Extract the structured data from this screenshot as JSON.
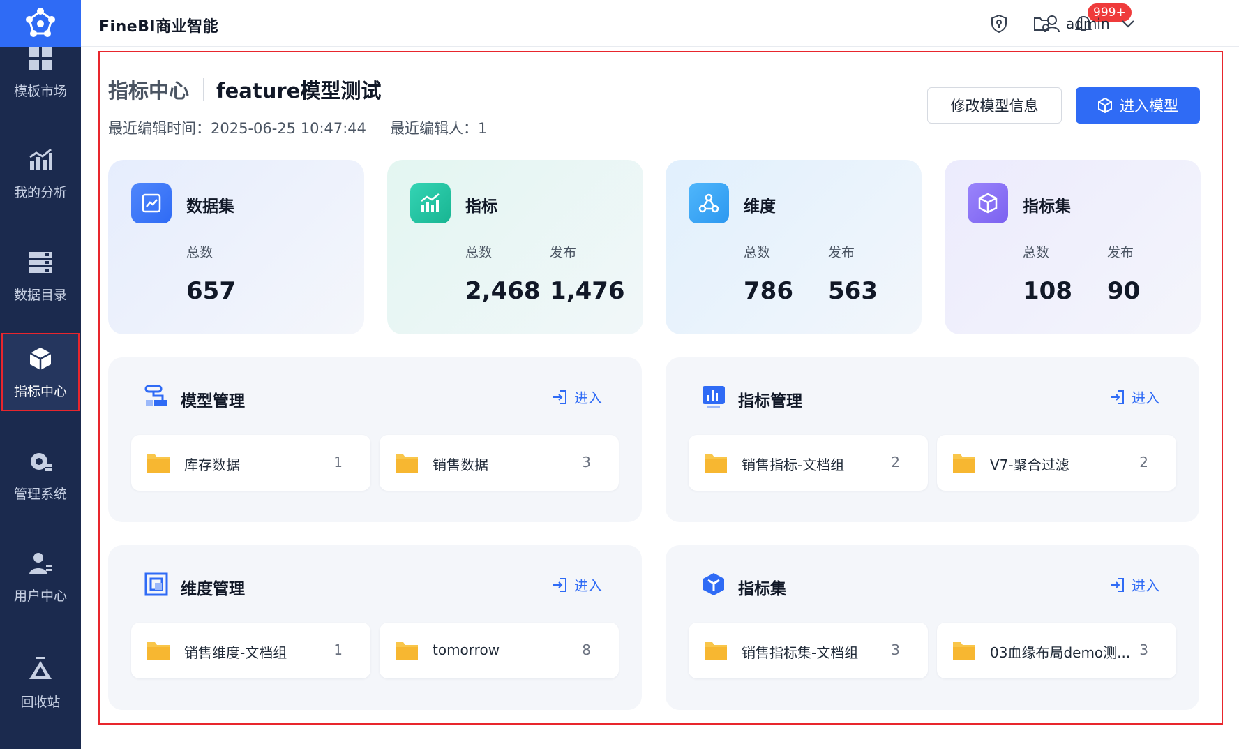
{
  "header": {
    "brand": "FineBI商业智能",
    "notification_badge": "999+",
    "user_name": "admin"
  },
  "sidebar": {
    "items": [
      {
        "label": "模板市场",
        "icon": "template-market-icon"
      },
      {
        "label": "我的分析",
        "icon": "analysis-chart-icon"
      },
      {
        "label": "数据目录",
        "icon": "data-catalog-icon"
      },
      {
        "label": "指标中心",
        "icon": "metric-center-cube-icon",
        "active": true
      },
      {
        "label": "管理系统",
        "icon": "gear-icon"
      },
      {
        "label": "用户中心",
        "icon": "user-icon"
      },
      {
        "label": "回收站",
        "icon": "recycle-icon"
      }
    ]
  },
  "page": {
    "section": "指标中心",
    "model_name": "feature模型测试",
    "last_edit_time": "最近编辑时间：2025-06-25 10:47:44",
    "last_editor": "最近编辑人：1",
    "btn_edit": "修改模型信息",
    "btn_enter": "进入模型"
  },
  "stats": [
    {
      "title": "数据集",
      "total_label": "总数",
      "total": "657"
    },
    {
      "title": "指标",
      "total_label": "总数",
      "total": "2,468",
      "pub_label": "发布",
      "pub": "1,476"
    },
    {
      "title": "维度",
      "total_label": "总数",
      "total": "786",
      "pub_label": "发布",
      "pub": "563"
    },
    {
      "title": "指标集",
      "total_label": "总数",
      "total": "108",
      "pub_label": "发布",
      "pub": "90"
    }
  ],
  "sections": [
    {
      "title": "模型管理",
      "enter": "进入",
      "items": [
        {
          "name": "库存数据",
          "count": "1"
        },
        {
          "name": "销售数据",
          "count": "3"
        }
      ]
    },
    {
      "title": "指标管理",
      "enter": "进入",
      "items": [
        {
          "name": "销售指标-文档组",
          "count": "2"
        },
        {
          "name": "V7-聚合过滤",
          "count": "2"
        }
      ]
    },
    {
      "title": "维度管理",
      "enter": "进入",
      "items": [
        {
          "name": "销售维度-文档组",
          "count": "1"
        },
        {
          "name": "tomorrow",
          "count": "8"
        }
      ]
    },
    {
      "title": "指标集",
      "enter": "进入",
      "items": [
        {
          "name": "销售指标集-文档组",
          "count": "3"
        },
        {
          "name": "03血缘布局demo测...",
          "count": "3"
        }
      ]
    }
  ],
  "colors": {
    "sidebar_bg": "#1b2a4e",
    "primary": "#2f6bf5",
    "highlight_border": "#e8262d",
    "badge": "#ef3b3b",
    "folder": "#f7b731"
  }
}
